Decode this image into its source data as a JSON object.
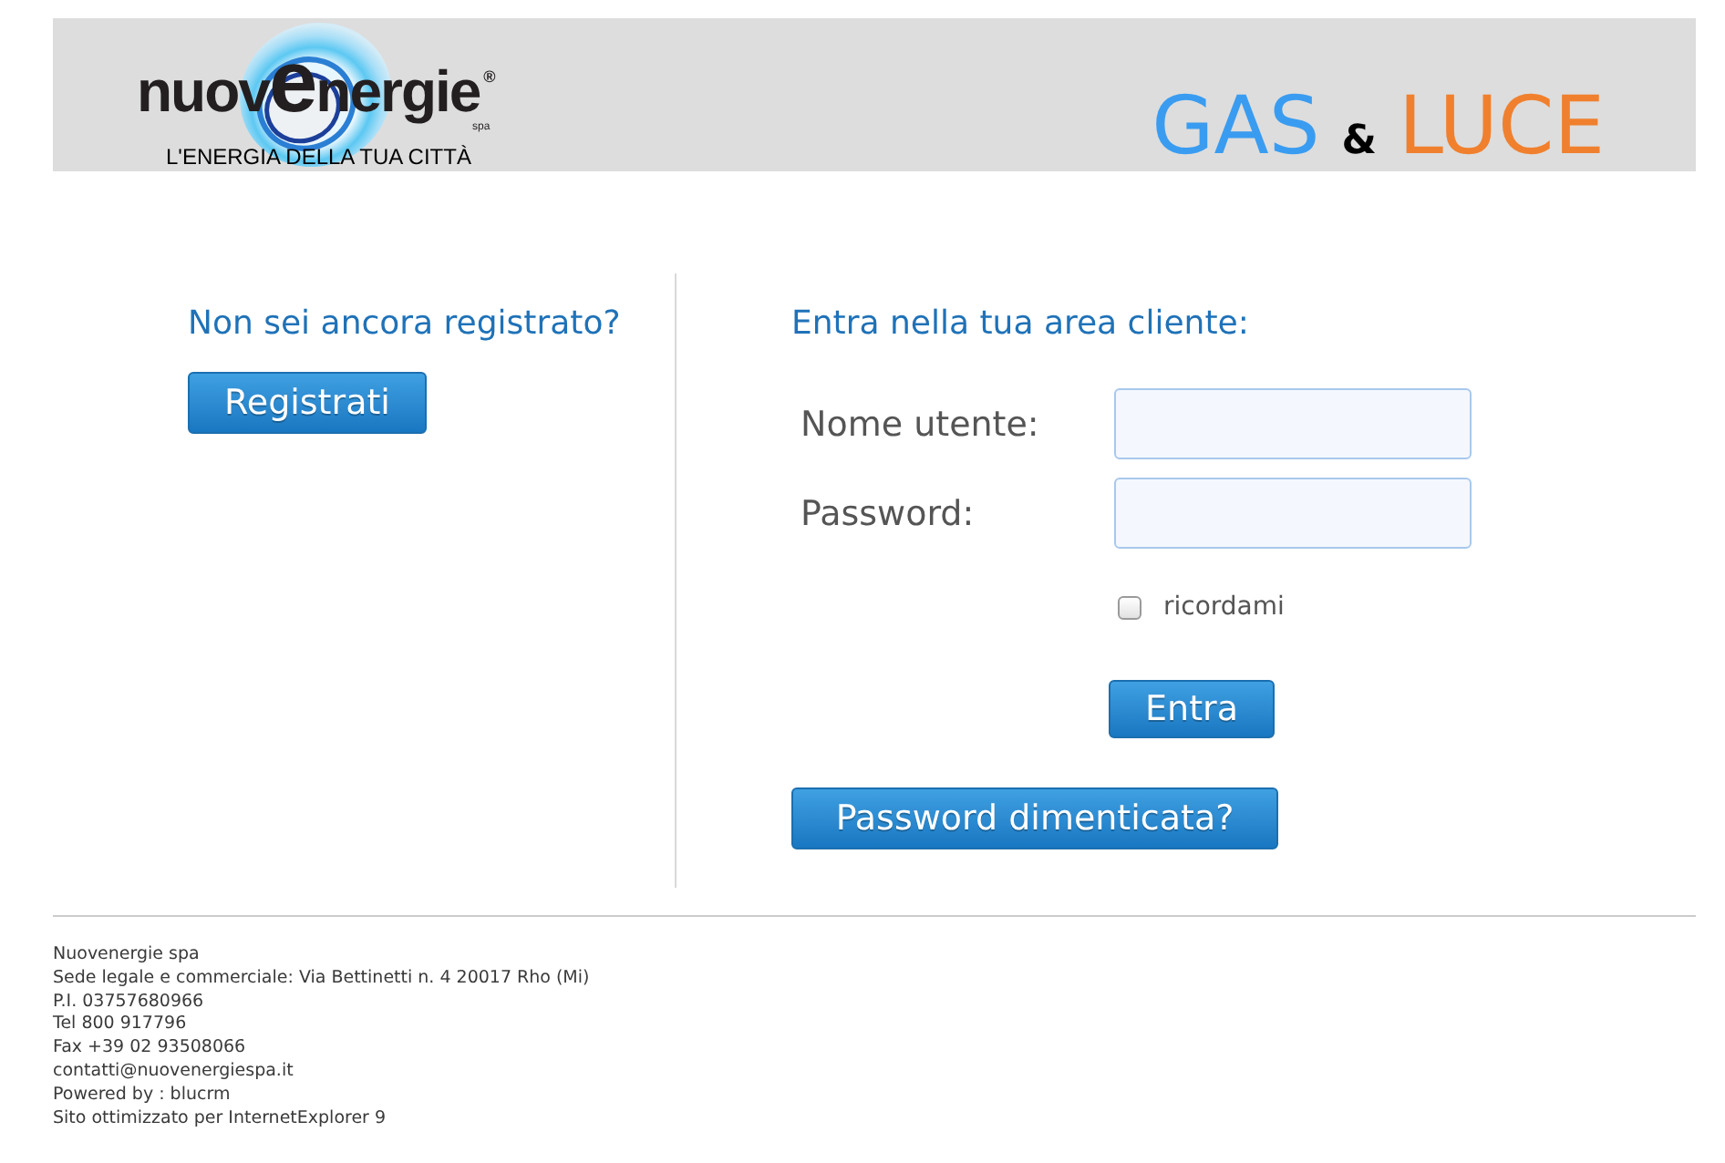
{
  "header": {
    "logo": {
      "name": [
        {
          "text": "nuov",
          "kind": "plain"
        },
        {
          "text": "e",
          "kind": "accent"
        },
        {
          "text": "nergie",
          "kind": "plain"
        }
      ],
      "mark": "®",
      "suffix": "spa",
      "tagline": "L'ENERGIA DELLA TUA CITTÀ"
    },
    "title": [
      {
        "text": "GAS",
        "kind": "word",
        "color": "#3a9cf0"
      },
      {
        "text": "&",
        "kind": "ampersand",
        "color": "#000000"
      },
      {
        "text": "LUCE",
        "kind": "word",
        "color": "#f0802e"
      }
    ]
  },
  "register": {
    "heading": "Non sei ancora registrato?",
    "button": "Registrati"
  },
  "login": {
    "heading": "Entra nella tua area cliente:",
    "fields": [
      {
        "label": "Nome utente:"
      },
      {
        "label": "Password:"
      }
    ],
    "remember": {
      "label": "ricordami",
      "checked": false
    },
    "submit": "Entra",
    "forgot": "Password dimenticata?"
  },
  "footer": {
    "lines": [
      "Nuovenergie spa",
      "Sede legale e commerciale: Via Bettinetti n. 4 20017 Rho (Mi)",
      "P.I. 03757680966",
      "Tel 800 917796",
      "Fax +39 02 93508066",
      "contatti@nuovenergiespa.it",
      "Powered by : blucrm",
      "Sito ottimizzato per InternetExplorer 9"
    ]
  }
}
